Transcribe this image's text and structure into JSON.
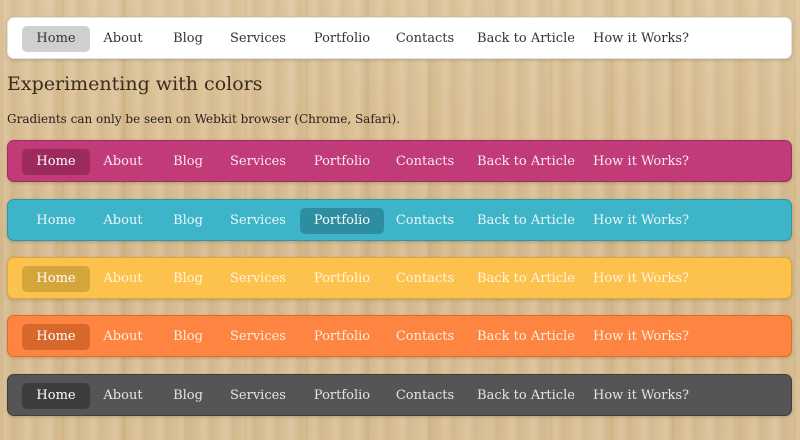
{
  "nav_items": [
    "Home",
    "About",
    "Blog",
    "Services",
    "Portfolio",
    "Contacts",
    "Back to Article",
    "How it Works?"
  ],
  "heading": "Experimenting with colors",
  "note": "Gradients can only be seen on Webkit browser (Chrome, Safari).",
  "navbars": [
    {
      "theme": "white",
      "color": "#ffffff",
      "active_label": "Home"
    },
    {
      "theme": "pink",
      "color": "#c03b77",
      "active_label": "Home"
    },
    {
      "theme": "cyan",
      "color": "#3eb4c8",
      "active_label": "Portfolio"
    },
    {
      "theme": "yellow",
      "color": "#fdc24e",
      "active_label": "Home"
    },
    {
      "theme": "orange",
      "color": "#fd8541",
      "active_label": "Home"
    },
    {
      "theme": "grey",
      "color": "#555555",
      "active_label": "Home"
    }
  ]
}
